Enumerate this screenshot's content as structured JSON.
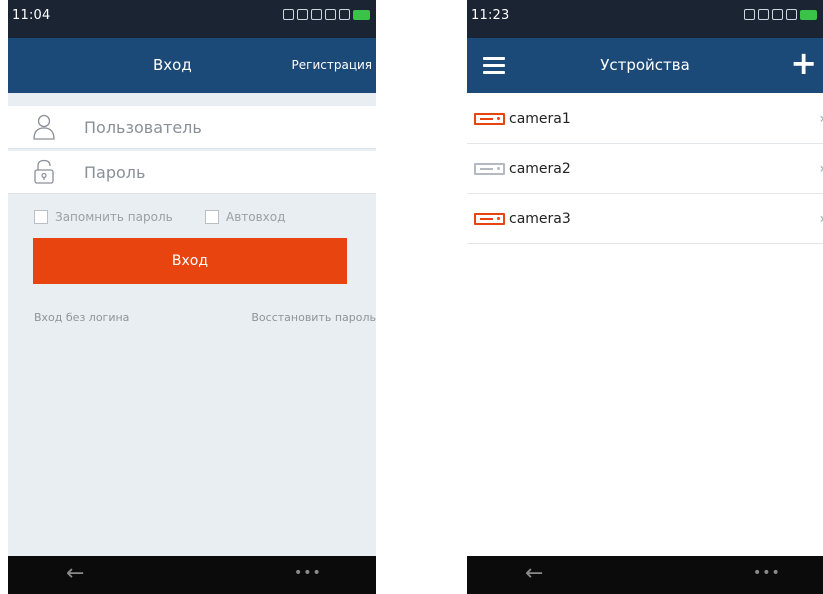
{
  "login_screen": {
    "status_time": "11:04",
    "title": "Вход",
    "register_link": "Регистрация",
    "username_placeholder": "Пользователь",
    "password_placeholder": "Пароль",
    "remember_password": "Запомнить пароль",
    "auto_login": "Автовход",
    "login_button": "Вход",
    "guest_login": "Вход без логина",
    "restore_password": "Восстановить пароль"
  },
  "devices_screen": {
    "status_time": "11:23",
    "title": "Устройства",
    "add_symbol": "+",
    "devices": [
      {
        "name": "camera1",
        "online": true
      },
      {
        "name": "camera2",
        "online": false
      },
      {
        "name": "camera3",
        "online": true
      }
    ]
  },
  "nav": {
    "back_symbol": "←",
    "more_symbol": "•••"
  },
  "colors": {
    "status_bar": "#1a2433",
    "app_bar": "#1b4a79",
    "primary_button": "#e8440f",
    "online_camera": "#e8440f",
    "offline_camera": "#b5bac0",
    "battery": "#3ac249"
  },
  "icons": [
    "user-icon",
    "lock-icon",
    "menu-icon",
    "add-icon",
    "camera-icon",
    "back-arrow-icon",
    "more-icon",
    "chevron-right-icon"
  ]
}
